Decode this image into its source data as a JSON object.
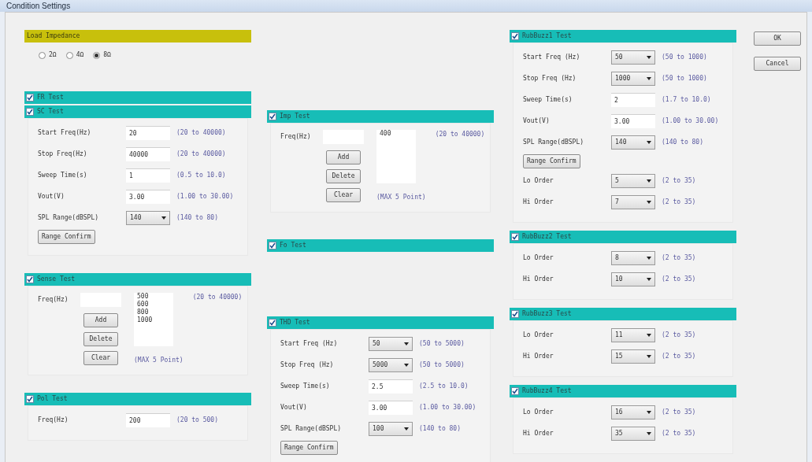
{
  "window": {
    "title": "Condition Settings"
  },
  "load_impedance": {
    "title": "Load Impedance",
    "options": [
      {
        "label": "2Ω",
        "selected": false
      },
      {
        "label": "4Ω",
        "selected": false
      },
      {
        "label": "8Ω",
        "selected": true
      }
    ]
  },
  "columns": [
    [
      {
        "title": "FR Test",
        "checked": true,
        "kind": "header"
      },
      {
        "title": "SC Test",
        "checked": true,
        "kind": "rows",
        "rows": [
          {
            "kind": "input",
            "label": "Start Freq(Hz)",
            "value": "20",
            "range": "(20 to 40000)"
          },
          {
            "kind": "input",
            "label": "Stop Freq(Hz)",
            "value": "40000",
            "range": "(20 to 40000)"
          },
          {
            "kind": "input",
            "label": "Sweep Time(s)",
            "value": "1",
            "range": "(0.5 to 10.0)"
          },
          {
            "kind": "input",
            "label": "Vout(V)",
            "value": "3.00",
            "range": "(1.00 to 30.00)"
          },
          {
            "kind": "select",
            "label": "SPL Range(dBSPL)",
            "value": "140",
            "range": "(140 to 80)"
          },
          {
            "kind": "button",
            "label": "Range Confirm"
          }
        ]
      },
      {
        "title": "Sense Test",
        "checked": true,
        "kind": "points",
        "label": "Freq(Hz)",
        "items": [
          "500",
          "600",
          "800",
          "1000"
        ],
        "range": "(20 to 40000)",
        "buttons": [
          "Add",
          "Delete",
          "Clear"
        ],
        "note": "(MAX 5 Point)"
      },
      {
        "title": "Pol Test",
        "checked": true,
        "kind": "rows",
        "rows": [
          {
            "kind": "input",
            "label": "Freq(Hz)",
            "value": "200",
            "range": "(20 to 500)"
          }
        ]
      }
    ],
    [
      {
        "title": "Imp Test",
        "checked": true,
        "kind": "points",
        "label": "Freq(Hz)",
        "items": [
          "400"
        ],
        "range": "(20 to 40000)",
        "buttons": [
          "Add",
          "Delete",
          "Clear"
        ],
        "note": "(MAX 5 Point)"
      },
      {
        "title": "Fo Test",
        "checked": true,
        "kind": "header"
      },
      {
        "title": "THD Test",
        "checked": true,
        "kind": "rows",
        "rows": [
          {
            "kind": "select",
            "label": "Start Freq (Hz)",
            "value": "50",
            "range": "(50 to 5000)"
          },
          {
            "kind": "select",
            "label": "Stop Freq (Hz)",
            "value": "5000",
            "range": "(50 to 5000)"
          },
          {
            "kind": "input",
            "label": "Sweep Time(s)",
            "value": "2.5",
            "range": "(2.5 to 10.0)"
          },
          {
            "kind": "input",
            "label": "Vout(V)",
            "value": "3.00",
            "range": "(1.00 to 30.00)"
          },
          {
            "kind": "select",
            "label": "SPL Range(dBSPL)",
            "value": "100",
            "range": "(140 to 80)"
          },
          {
            "kind": "button",
            "label": "Range Confirm"
          }
        ]
      }
    ],
    [
      {
        "title": "RubBuzz1 Test",
        "checked": true,
        "kind": "rows",
        "rows": [
          {
            "kind": "select",
            "label": "Start Freq (Hz)",
            "value": "50",
            "range": "(50 to 1000)"
          },
          {
            "kind": "select",
            "label": "Stop Freq (Hz)",
            "value": "1000",
            "range": "(50 to 1000)"
          },
          {
            "kind": "input",
            "label": "Sweep Time(s)",
            "value": "2",
            "range": "(1.7 to 10.0)"
          },
          {
            "kind": "input",
            "label": "Vout(V)",
            "value": "3.00",
            "range": "(1.00 to 30.00)"
          },
          {
            "kind": "select",
            "label": "SPL Range(dBSPL)",
            "value": "140",
            "range": "(140 to 80)"
          },
          {
            "kind": "button",
            "label": "Range Confirm"
          },
          {
            "kind": "select",
            "label": "Lo Order",
            "value": "5",
            "range": "(2 to 35)"
          },
          {
            "kind": "select",
            "label": "Hi Order",
            "value": "7",
            "range": "(2 to 35)"
          }
        ]
      },
      {
        "title": "RubBuzz2 Test",
        "checked": true,
        "kind": "rows",
        "rows": [
          {
            "kind": "select",
            "label": "Lo Order",
            "value": "8",
            "range": "(2 to 35)"
          },
          {
            "kind": "select",
            "label": "Hi Order",
            "value": "10",
            "range": "(2 to 35)"
          }
        ]
      },
      {
        "title": "RubBuzz3 Test",
        "checked": true,
        "kind": "rows",
        "rows": [
          {
            "kind": "select",
            "label": "Lo Order",
            "value": "11",
            "range": "(2 to 35)"
          },
          {
            "kind": "select",
            "label": "Hi Order",
            "value": "15",
            "range": "(2 to 35)"
          }
        ]
      },
      {
        "title": "RubBuzz4 Test",
        "checked": true,
        "kind": "rows",
        "rows": [
          {
            "kind": "select",
            "label": "Lo Order",
            "value": "16",
            "range": "(2 to 35)"
          },
          {
            "kind": "select",
            "label": "Hi Order",
            "value": "35",
            "range": "(2 to 35)"
          }
        ]
      }
    ]
  ],
  "buttons": [
    "OK",
    "Cancel"
  ]
}
